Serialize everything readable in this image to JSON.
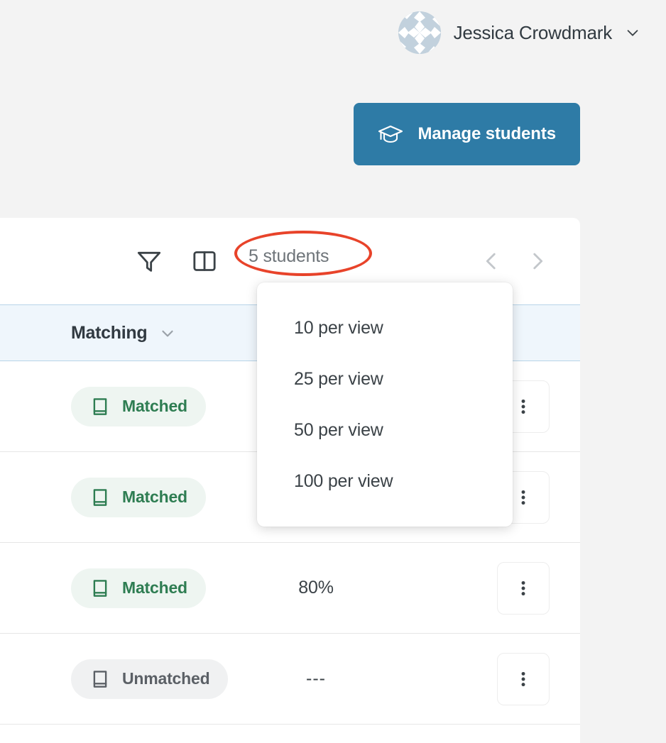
{
  "topbar": {
    "user_name": "Jessica Crowdmark",
    "caret_icon": "chevron-down-icon",
    "avatar_icon": "user-avatar-identicon"
  },
  "actions": {
    "manage_students_label": "Manage students",
    "manage_students_icon": "graduation-cap-icon",
    "primary_color": "#2e7ba6"
  },
  "toolbar": {
    "filter_icon": "filter-icon",
    "columns_icon": "columns-icon",
    "count_label": "5 students",
    "prev_icon": "chevron-left-icon",
    "next_icon": "chevron-right-icon",
    "annotation_color": "#e8432a"
  },
  "per_view_menu": {
    "options": [
      {
        "label": "10 per view"
      },
      {
        "label": "25 per view"
      },
      {
        "label": "50 per view"
      },
      {
        "label": "100 per view"
      }
    ]
  },
  "table": {
    "header": {
      "matching_label": "Matching",
      "sort_icon": "chevron-down-icon",
      "background": "#eff6fc"
    },
    "rows": [
      {
        "status": "Matched",
        "status_kind": "matched",
        "status_icon": "book-icon",
        "score": ""
      },
      {
        "status": "Matched",
        "status_kind": "matched",
        "status_icon": "book-icon",
        "score": ""
      },
      {
        "status": "Matched",
        "status_kind": "matched",
        "status_icon": "book-icon",
        "score": "80%"
      },
      {
        "status": "Unmatched",
        "status_kind": "unmatched",
        "status_icon": "book-icon",
        "score": "---"
      }
    ],
    "row_menu_icon": "kebab-menu-icon",
    "matched_color": "#2e7d52",
    "unmatched_color": "#5b6066"
  }
}
